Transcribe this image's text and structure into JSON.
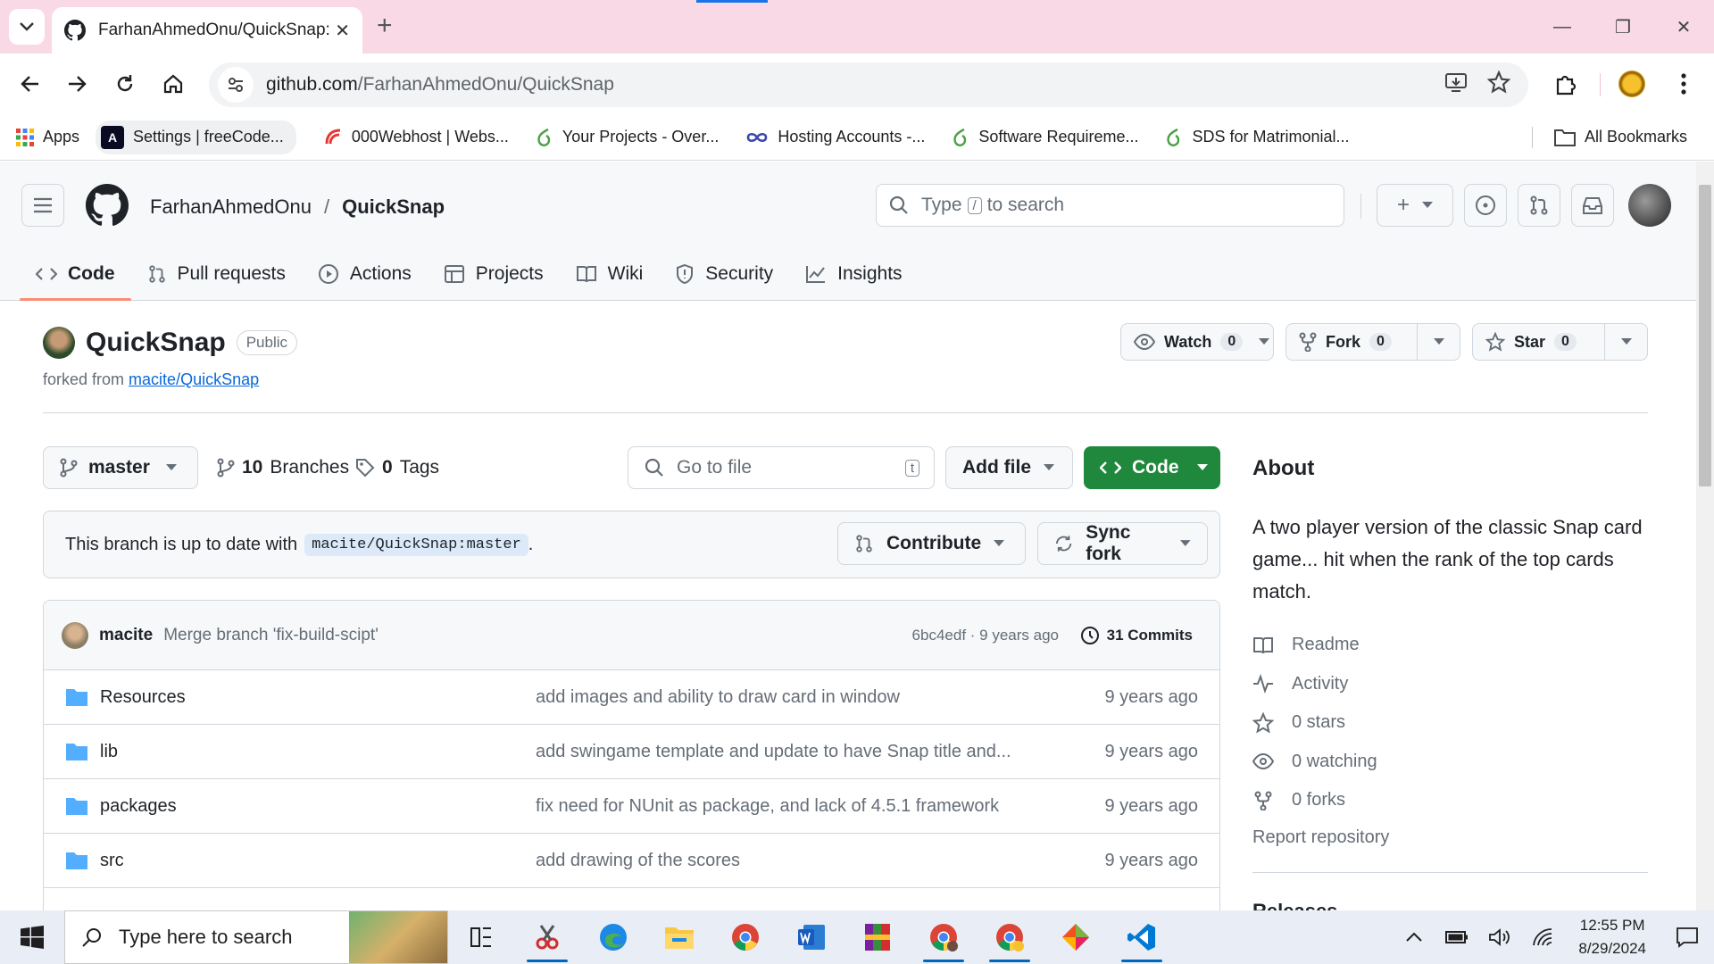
{
  "browser": {
    "tab_title": "FarhanAhmedOnu/QuickSnap: A",
    "url_host": "github.com",
    "url_path": "/FarhanAhmedOnu/QuickSnap",
    "bookmarks": [
      {
        "label": "Apps",
        "icon": "apps-grid-icon"
      },
      {
        "label": "Settings | freeCode...",
        "icon": "freecodecamp-icon"
      },
      {
        "label": "000Webhost | Webs...",
        "icon": "webhost-icon"
      },
      {
        "label": "Your Projects - Over...",
        "icon": "overleaf-icon"
      },
      {
        "label": "Hosting Accounts -...",
        "icon": "infinity-icon"
      },
      {
        "label": "Software Requireme...",
        "icon": "overleaf-icon"
      },
      {
        "label": "SDS for Matrimonial...",
        "icon": "overleaf-icon"
      }
    ],
    "all_bookmarks": "All Bookmarks"
  },
  "github": {
    "owner": "FarhanAhmedOnu",
    "separator": "/",
    "repo": "QuickSnap",
    "search_placeholder_pre": "Type",
    "search_key": "/",
    "search_placeholder_post": "to search",
    "nav": [
      {
        "label": "Code",
        "icon": "code-icon"
      },
      {
        "label": "Pull requests",
        "icon": "pull-request-icon"
      },
      {
        "label": "Actions",
        "icon": "play-circle-icon"
      },
      {
        "label": "Projects",
        "icon": "table-icon"
      },
      {
        "label": "Wiki",
        "icon": "book-icon"
      },
      {
        "label": "Security",
        "icon": "shield-icon"
      },
      {
        "label": "Insights",
        "icon": "graph-icon"
      }
    ],
    "visibility": "Public",
    "forked_from_prefix": "forked from",
    "forked_from": "macite/QuickSnap",
    "watch": {
      "label": "Watch",
      "count": "0"
    },
    "fork": {
      "label": "Fork",
      "count": "0"
    },
    "star": {
      "label": "Star",
      "count": "0"
    },
    "branch": "master",
    "branches_count": "10",
    "branches_label": "Branches",
    "tags_count": "0",
    "tags_label": "Tags",
    "goto_placeholder": "Go to file",
    "goto_key": "t",
    "add_file": "Add file",
    "code_button": "Code",
    "uptodate_text": "This branch is up to date with",
    "uptodate_ref": "macite/QuickSnap:master",
    "uptodate_period": ".",
    "contribute": "Contribute",
    "sync_fork": "Sync fork",
    "latest_commit": {
      "author": "macite",
      "message": "Merge branch 'fix-build-scipt'",
      "meta": "6bc4edf · 9 years ago",
      "commits_label": "31 Commits"
    },
    "files": [
      {
        "name": "Resources",
        "message": "add images and ability to draw card in window",
        "date": "9 years ago"
      },
      {
        "name": "lib",
        "message": "add swingame template and update to have Snap title and...",
        "date": "9 years ago"
      },
      {
        "name": "packages",
        "message": "fix need for NUnit as package, and lack of 4.5.1 framework",
        "date": "9 years ago"
      },
      {
        "name": "src",
        "message": "add drawing of the scores",
        "date": "9 years ago"
      }
    ],
    "about": {
      "title": "About",
      "description": "A two player version of the classic Snap card game... hit when the rank of the top cards match.",
      "readme": "Readme",
      "activity": "Activity",
      "stars": "0 stars",
      "watching": "0 watching",
      "forks": "0 forks",
      "report": "Report repository",
      "releases": "Releases"
    }
  },
  "taskbar": {
    "search_placeholder": "Type here to search",
    "time": "12:55 PM",
    "date": "8/29/2024"
  },
  "colors": {
    "tab_strip": "#f9d9e6",
    "code_button": "#1f883d",
    "link": "#0969da",
    "active_tab_underline": "#fd8c73"
  }
}
